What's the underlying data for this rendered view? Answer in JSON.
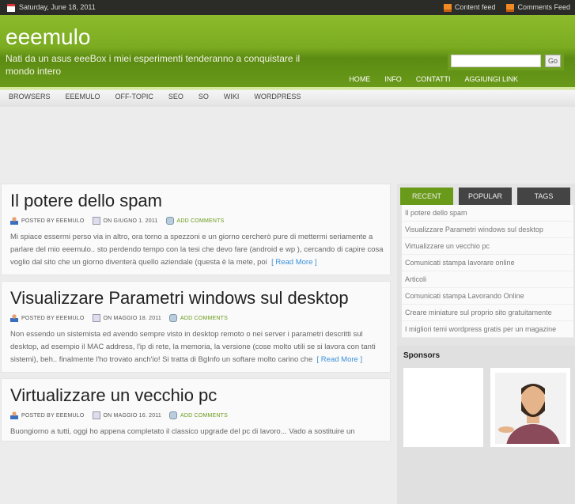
{
  "topbar": {
    "date": "Saturday, June 18, 2011",
    "content_feed": "Content feed",
    "comments_feed": "Comments Feed"
  },
  "header": {
    "title": "eeemulo",
    "tagline": "Nati da un asus eeeBox i miei esperimenti tenderanno a conquistare il mondo intero",
    "search_value": "",
    "search_button": "Go",
    "pages": [
      "HOME",
      "INFO",
      "CONTATTI",
      "AGGIUNGI LINK"
    ]
  },
  "categories": [
    "BROWSERS",
    "EEEMULO",
    "OFF-TOPIC",
    "SEO",
    "SO",
    "WIKI",
    "WORDPRESS"
  ],
  "posts": [
    {
      "title": "Il potere dello spam",
      "author": "POSTED BY EEEMULO",
      "date": "ON GIUGNO 1. 2011",
      "comments": "ADD COMMENTS",
      "excerpt": "Mi spiace essermi perso via in altro, ora torno a spezzoni e un giorno cercherò pure di mettermi seriamente a parlare del mio eeemulo.. sto perdendo tempo con la tesi che devo fare (android e wp ), cercando di capire cosa voglio dal sito che un giorno diventerà quello aziendale (questa è la mete, poi",
      "read_more": "[ Read More ]"
    },
    {
      "title": "Visualizzare Parametri windows sul desktop",
      "author": "POSTED BY EEEMULO",
      "date": "ON MAGGIO 18. 2011",
      "comments": "ADD COMMENTS",
      "excerpt": "Non essendo un sistemista ed avendo sempre visto in desktop remoto o nei server i parametri descritti sul desktop, ad esempio il MAC address, l'ip di rete, la memoria, la versione (cose molto utili se si lavora con tanti sistemi), beh.. finalmente l'ho trovato anch'io!   Si tratta di BgInfo un softare molto carino che",
      "read_more": "[ Read More ]"
    },
    {
      "title": "Virtualizzare un vecchio pc",
      "author": "POSTED BY EEEMULO",
      "date": "ON MAGGIO 16. 2011",
      "comments": "ADD COMMENTS",
      "excerpt": "Buongiorno a tutti, oggi ho appena completato il classico upgrade del pc di lavoro... Vado a sostituire un"
    }
  ],
  "sidebar": {
    "tabs": [
      "RECENT",
      "POPULAR",
      "TAGS"
    ],
    "recent": [
      "Il potere dello spam",
      "Visualizzare Parametri windows sul desktop",
      "Virtualizzare un vecchio pc",
      "Comunicati stampa lavorare online",
      "Articoli",
      "Comunicati stampa Lavorando Online",
      "Creare miniature sul proprio sito gratuitamente",
      "I migliori temi wordpress gratis per un magazine"
    ],
    "sponsors_title": "Sponsors"
  }
}
